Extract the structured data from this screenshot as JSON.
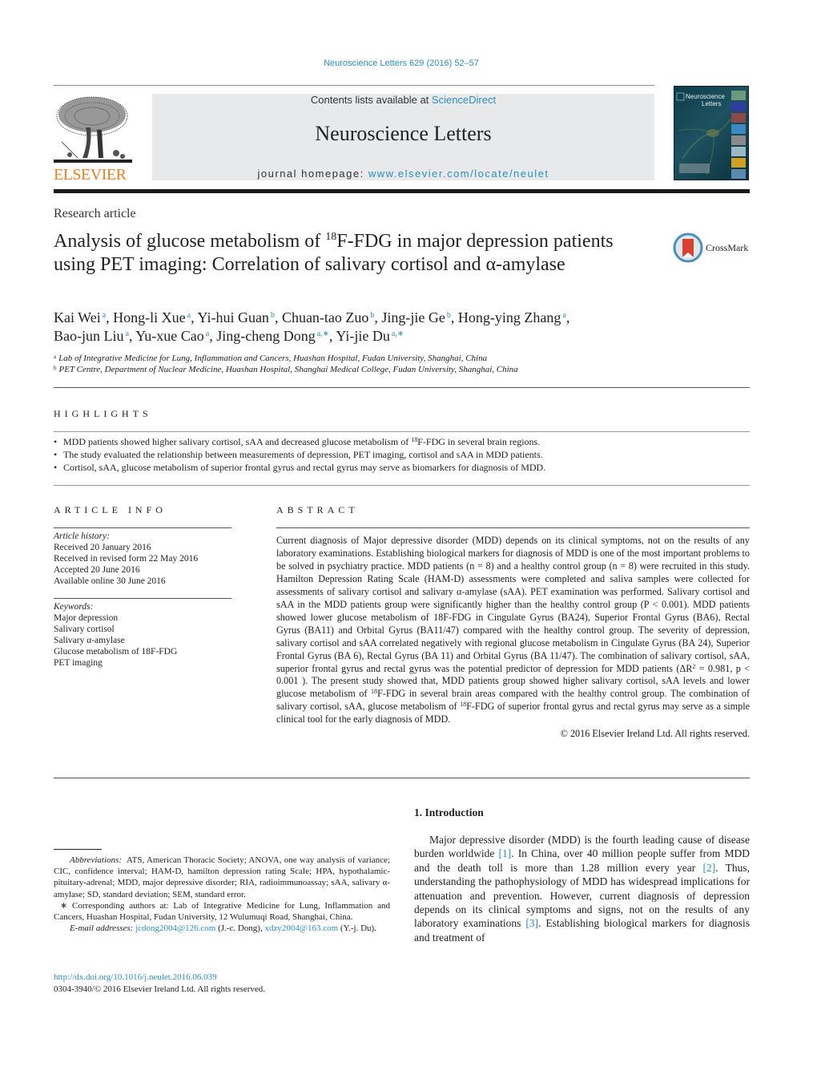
{
  "header": {
    "journal_ref": "Neuroscience Letters 629 (2016) 52–57",
    "contents_prefix": "Contents lists available at ",
    "contents_link": "ScienceDirect",
    "journal_name": "Neuroscience Letters",
    "homepage_prefix": "journal homepage: ",
    "homepage_link": "www.elsevier.com/locate/neulet",
    "publisher_logo_text": "ELSEVIER",
    "cover_title_line1": "Neuroscience",
    "cover_title_line2": "Letters"
  },
  "article": {
    "type": "Research article",
    "title_part1": "Analysis of glucose metabolism of ",
    "title_sup": "18",
    "title_part2": "F-FDG in major depression patients using PET imaging: Correlation of salivary cortisol and α-amylase",
    "crossmark_label": "CrossMark"
  },
  "authors": [
    {
      "name": "Kai Wei",
      "aff": "a"
    },
    {
      "name": "Hong-li Xue",
      "aff": "a"
    },
    {
      "name": "Yi-hui Guan",
      "aff": "b"
    },
    {
      "name": "Chuan-tao Zuo",
      "aff": "b"
    },
    {
      "name": "Jing-jie Ge",
      "aff": "b"
    },
    {
      "name": "Hong-ying Zhang",
      "aff": "a"
    },
    {
      "name": "Bao-jun Liu",
      "aff": "a"
    },
    {
      "name": "Yu-xue Cao",
      "aff": "a"
    },
    {
      "name": "Jing-cheng Dong",
      "aff": "a,∗"
    },
    {
      "name": "Yi-jie Du",
      "aff": "a,∗"
    }
  ],
  "affiliations": [
    {
      "key": "a",
      "text": "Lab of Integrative Medicine for Lung, Inflammation and Cancers, Huashan Hospital, Fudan University, Shanghai, China"
    },
    {
      "key": "b",
      "text": "PET Centre, Department of Nuclear Medicine, Huashan Hospital, Shanghai Medical College, Fudan University, Shanghai, China"
    }
  ],
  "highlights": {
    "heading": "HIGHLIGHTS",
    "item1_pre": "MDD patients showed higher salivary cortisol, sAA and decreased glucose metabolism of ",
    "item1_sup": "18",
    "item1_post": "F-FDG in several brain regions.",
    "item2": "The study evaluated the relationship between measurements of depression, PET imaging, cortisol and sAA in MDD patients.",
    "item3": "Cortisol, sAA, glucose metabolism of superior frontal gyrus and rectal gyrus may serve as biomarkers for diagnosis of MDD."
  },
  "article_info": {
    "heading": "ARTICLE INFO",
    "history_label": "Article history:",
    "history": [
      "Received 20 January 2016",
      "Received in revised form 22 May 2016",
      "Accepted 20 June 2016",
      "Available online 30 June 2016"
    ],
    "keywords_label": "Keywords:",
    "keywords": [
      "Major depression",
      "Salivary cortisol",
      "Salivary α-amylase",
      "Glucose metabolism of 18F-FDG",
      "PET imaging"
    ]
  },
  "abstract": {
    "heading": "ABSTRACT",
    "part1": "Current diagnosis of Major depressive disorder (MDD) depends on its clinical symptoms, not on the results of any laboratory examinations. Establishing biological markers for diagnosis of MDD is one of the most important problems to be solved in psychiatry practice. MDD patients (n = 8) and a healthy control group (n = 8) were recruited in this study. Hamilton Depression Rating Scale (HAM-D) assessments were completed and saliva samples were collected for assessments of salivary cortisol and salivary α-amylase (sAA). PET examination was performed. Salivary cortisol and sAA in the MDD patients group were significantly higher than the healthy control group (P < 0.001). MDD patients showed lower glucose metabolism of 18F-FDG in Cingulate Gyrus (BA24), Superior Frontal Gyrus (BA6), Rectal Gyrus (BA11) and Orbital Gyrus (BA11/47) compared with the healthy control group. The severity of depression, salivary cortisol and sAA correlated negatively with regional glucose metabolism in Cingulate Gyrus (BA 24), Superior Frontal Gyrus (BA 6), Rectal Gyrus (BA 11) and Orbital Gyrus (BA 11/47). The combination of salivary cortisol, sAA, superior frontal gyrus and rectal gyrus was the potential predictor of depression for MDD patients (ΔR",
    "sup_r2": "2",
    "part2": " = 0.981, p < 0.001 ). The present study showed that, MDD patients group showed higher salivary cortisol, sAA levels and lower glucose metabolism of ",
    "sup_18a": "18",
    "part3": "F-FDG in several brain areas compared with the healthy control group. The combination of salivary cortisol, sAA, glucose metabolism of ",
    "sup_18b": "18",
    "part4": "F-FDG of superior frontal gyrus and rectal gyrus may serve as a simple clinical tool for the early diagnosis of MDD.",
    "copyright": "© 2016 Elsevier Ireland Ltd. All rights reserved."
  },
  "footnotes": {
    "abbreviations_label": "Abbreviations:",
    "abbreviations": "ATS, American Thoracic Society; ANOVA, one way analysis of variance; CIC, confidence interval; HAM-D, hamilton depression rating Scale; HPA, hypothalamic-pituitary-adrenal; MDD, major depressive disorder; RIA, radioimmunoassay; sAA, salivary α-amylase; SD, standard deviation; SEM, standard error.",
    "corresponding_marker": "∗",
    "corresponding": "Corresponding authors at: Lab of Integrative Medicine for Lung, Inflammation and Cancers, Huashan Hospital, Fudan University, 12 Wulumuqi Road, Shanghai, China.",
    "email_label": "E-mail addresses:",
    "email1": "jcdong2004@126.com",
    "email1_who": " (J.-c. Dong), ",
    "email2": "xdzy2004@163.com",
    "email2_who": " (Y.-j. Du)."
  },
  "doi": {
    "link": "http://dx.doi.org/10.1016/j.neulet.2016.06.039",
    "issn_copyright": "0304-3940/© 2016 Elsevier Ireland Ltd. All rights reserved."
  },
  "introduction": {
    "heading": "1.  Introduction",
    "t1": "Major depressive disorder (MDD) is the fourth leading cause of disease burden worldwide ",
    "ref1": "[1]",
    "t2": ". In China, over 40 million people suffer from MDD and the death toll is more than 1.28 million every year ",
    "ref2": "[2]",
    "t3": ". Thus, understanding the pathophysiology of MDD has widespread implications for attenuation and prevention. However, current diagnosis of depression depends on its clinical symptoms and signs, not on the results of any laboratory examinations ",
    "ref3": "[3]",
    "t4": ". Establishing biological markers for diagnosis and treatment of"
  },
  "colors": {
    "link": "#2a8fc0",
    "elsevier_orange": "#f07f1c",
    "banner_bg": "#e8e9ea",
    "crossmark_red": "#d8402f",
    "crossmark_blue": "#4a90b8"
  }
}
